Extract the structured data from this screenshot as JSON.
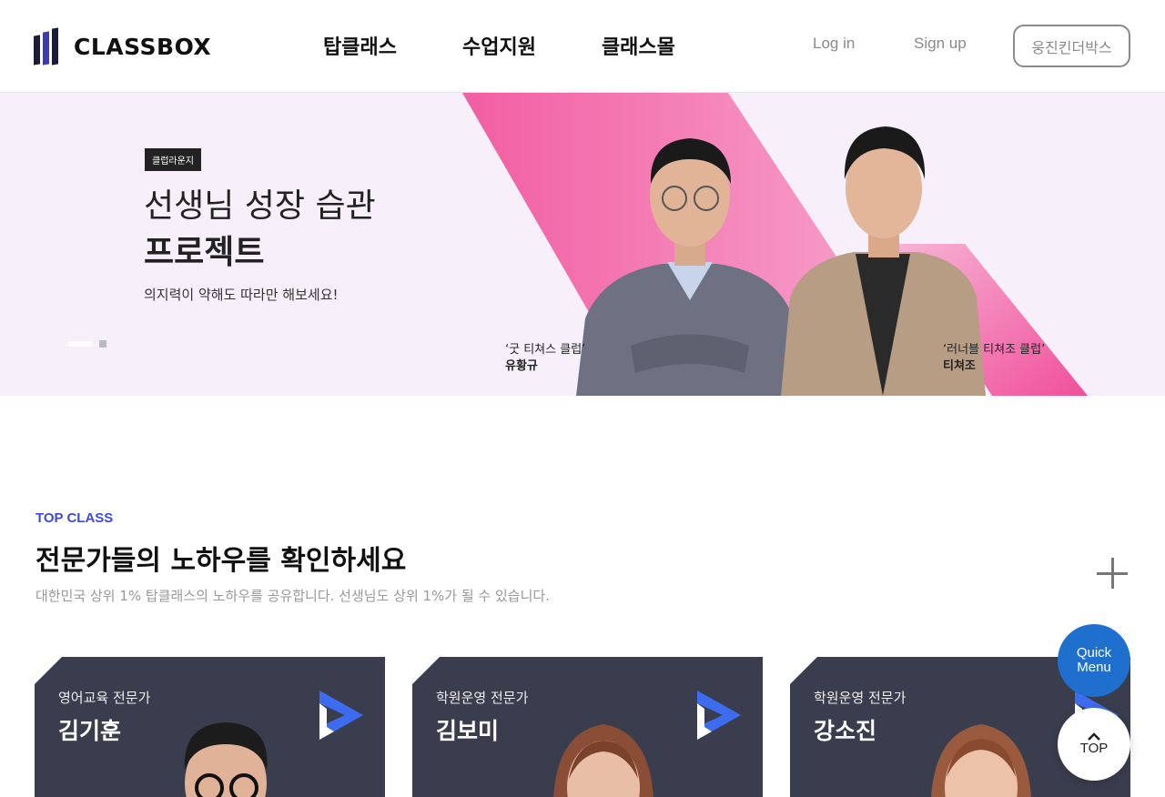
{
  "header": {
    "logo_text": "CLASSBOX",
    "nav": [
      "탑클래스",
      "수업지원",
      "클래스몰"
    ],
    "login": "Log in",
    "signup": "Sign up",
    "brand_button": "웅진킨더박스"
  },
  "banner": {
    "badge": "클럽라운지",
    "title_line1": "선생님 성장 습관",
    "title_line2": "프로젝트",
    "subtitle": "의지력이 약해도 따라만 해보세요!",
    "people": [
      {
        "club": "‘굿 티쳐스 클럽’",
        "name": "유황규"
      },
      {
        "club": "‘러너블 티쳐조 클럽’",
        "name": "티쳐조"
      }
    ]
  },
  "top_class": {
    "tag": "TOP CLASS",
    "title": "전문가들의 노하우를 확인하세요",
    "subtitle": "대한민국 상위 1% 탑클래스의 노하우를 공유합니다. 선생님도 상위 1%가 될 수 있습니다.",
    "cards": [
      {
        "role": "영어교육 전문가",
        "name": "김기훈"
      },
      {
        "role": "학원운영 전문가",
        "name": "김보미"
      },
      {
        "role": "학원운영 전문가",
        "name": "강소진"
      }
    ]
  },
  "floating": {
    "quick_menu_line1": "Quick",
    "quick_menu_line2": "Menu",
    "top_label": "TOP"
  },
  "colors": {
    "accent_blue": "#3d4bd6",
    "banner_pink": "#f06aa8",
    "card_bg": "#3a3d4e",
    "quick_menu": "#1e6fce"
  }
}
